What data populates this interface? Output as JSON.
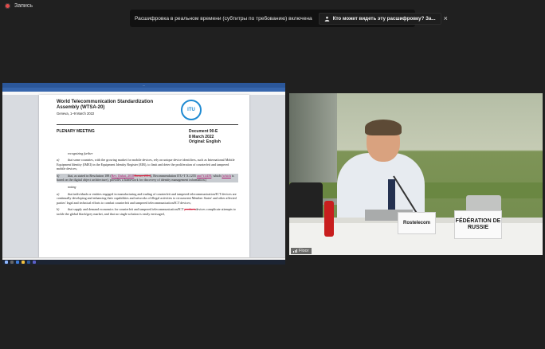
{
  "recording": {
    "label": "Запись"
  },
  "banner": {
    "text": "Расшифровка в реальном времени (субтитры по требованию) включена",
    "button": "Кто может видеть эту расшифровку? За...",
    "close": "×"
  },
  "shared_screen": {
    "word_title": "...",
    "document": {
      "org_line1": "World Telecommunication Standardization",
      "org_line2": "Assembly (WTSA-20)",
      "place": "Geneva, 1–9 March 2022",
      "logo": "ITU",
      "meeting": "PLENARY MEETING",
      "doc_number": "Document 90-E",
      "date": "8 March 2022",
      "original": "Original: English",
      "heading_recognizing": "recognizing further",
      "paras": [
        {
          "mark": "a)",
          "text": "that some countries, with the growing market for mobile devices, rely on unique device identifiers, such as International Mobile Equipment Identity (IMEI) in the Equipment Identity Register (EIR), to limit and deter the proliferation of counterfeit and tampered mobile devices;"
        },
        {
          "mark": "b)",
          "t1": "that, as stated in Resolution 188 (",
          "ins": "Rev. Dubai, 2018",
          "del": "Busan, 2014",
          "t2": "), Recommendation ITU-T X.1255 ",
          "ins2": "and Y.4459",
          "t3": ", which ",
          "ins3": "(which",
          "t4": " is based on the digital object architecture), provides a framework for discovery of identity management information.",
          "t5": ")"
        }
      ],
      "heading_noting": "noting",
      "paras2": [
        {
          "mark": "a)",
          "text": "that individuals or entities engaged in manufacturing and trading of counterfeit and tampered telecommunication/ICT devices are continually developing and enhancing their capabilities and networks of illegal activities to circumvent Member States' and other affected parties' legal and technical efforts to combat counterfeit and tampered telecommunication/ICT devices;"
        },
        {
          "mark": "b)",
          "t1": "that supply and demand economics for counterfeit and tampered telecommunication/ICT ",
          "del": "products",
          "t2": "devices complicate attempts to tackle the global black/grey market, and that no single solution is easily envisaged,"
        }
      ]
    }
  },
  "video": {
    "nameplate_left": "Rostelecom",
    "nameplate_right_line1": "FÉDÉRATION DE",
    "nameplate_right_line2": "RUSSIE",
    "floor_label": "Floor"
  }
}
